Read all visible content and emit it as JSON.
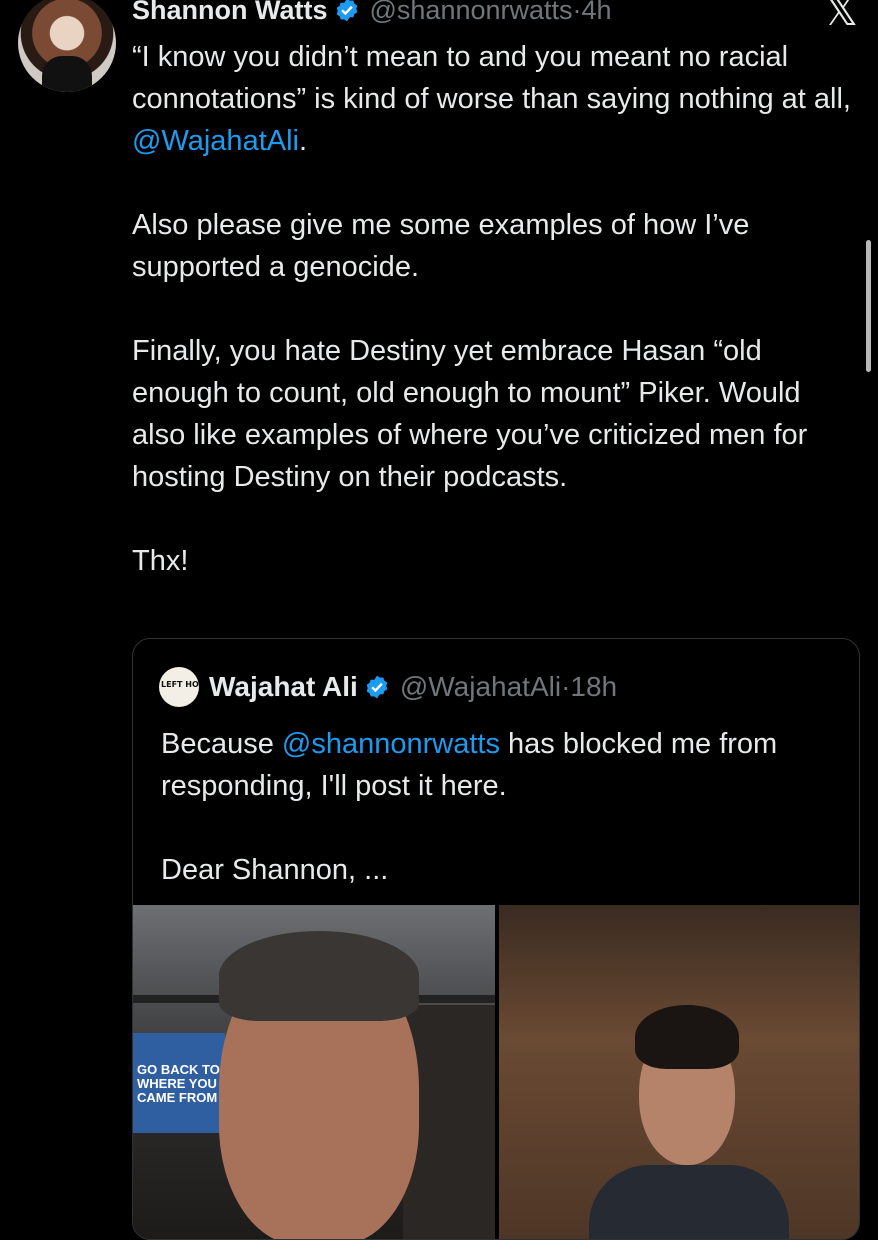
{
  "tweet": {
    "author_name": "Shannon Watts",
    "author_handle": "@shannonrwatts",
    "separator": "·",
    "time": "4h",
    "close_glyph": "𝕏",
    "paragraphs": [
      {
        "before": "“I know you didn’t mean to and you meant no racial connotations” is kind of worse than saying nothing at all, ",
        "mention": "@WajahatAli",
        "after": "."
      },
      {
        "text": "Also please give me some examples of how I’ve supported a genocide."
      },
      {
        "text": "Finally, you hate Destiny yet embrace Hasan “old enough to count, old enough to mount” Piker. Would also like examples of where you’ve criticized men for hosting Destiny on their podcasts."
      },
      {
        "text": "Thx!"
      }
    ]
  },
  "quoted": {
    "author_name": "Wajahat Ali",
    "author_handle": "@WajahatAli",
    "separator": "·",
    "time": "18h",
    "avatar_text": "LEFT HOOK",
    "p1_before": "Because ",
    "p1_mention": "@shannonrwatts",
    "p1_after": " has blocked me from responding, I'll post it here.",
    "p2": "Dear Shannon, ...",
    "book_title": "GO BACK TO WHERE YOU CAME FROM"
  },
  "colors": {
    "background": "#000000",
    "text": "#e7e9ea",
    "muted": "#71767b",
    "link": "#1d9bf0",
    "verified": "#1d9bf0",
    "border": "#2f3336"
  },
  "icons": {
    "verified": "verified-badge-icon",
    "close": "x-logo-icon"
  }
}
